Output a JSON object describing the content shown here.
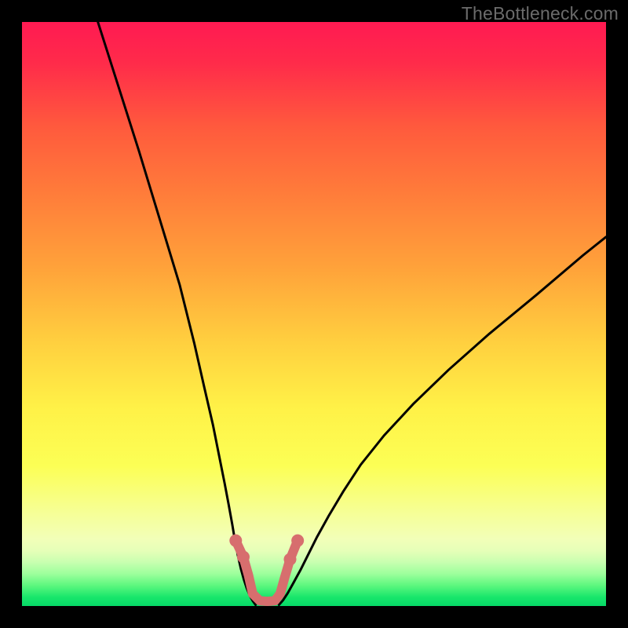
{
  "watermark": "TheBottleneck.com",
  "chart_data": {
    "type": "line",
    "title": "",
    "xlabel": "",
    "ylabel": "",
    "xlim": [
      0,
      100
    ],
    "ylim": [
      0,
      100
    ],
    "gradient_stops": [
      {
        "offset": 0,
        "color": "#ff1a52"
      },
      {
        "offset": 0.07,
        "color": "#ff2b4a"
      },
      {
        "offset": 0.18,
        "color": "#ff5a3d"
      },
      {
        "offset": 0.3,
        "color": "#ff7e3a"
      },
      {
        "offset": 0.42,
        "color": "#ffa23a"
      },
      {
        "offset": 0.55,
        "color": "#ffd03f"
      },
      {
        "offset": 0.66,
        "color": "#fff147"
      },
      {
        "offset": 0.76,
        "color": "#fcff55"
      },
      {
        "offset": 0.84,
        "color": "#f6ff96"
      },
      {
        "offset": 0.885,
        "color": "#f2ffb8"
      },
      {
        "offset": 0.905,
        "color": "#e6ffb8"
      },
      {
        "offset": 0.925,
        "color": "#c8ffb0"
      },
      {
        "offset": 0.945,
        "color": "#9cff9c"
      },
      {
        "offset": 0.965,
        "color": "#5cf77e"
      },
      {
        "offset": 0.985,
        "color": "#18e66b"
      },
      {
        "offset": 1.0,
        "color": "#06d967"
      }
    ],
    "series": [
      {
        "name": "left-branch",
        "x": [
          13.0,
          16.5,
          20.0,
          23.5,
          27.0,
          29.5,
          31.2,
          32.7,
          33.8,
          34.7,
          35.4,
          36.0,
          36.5,
          37.0,
          37.5,
          38.0,
          38.5,
          39.0,
          39.5,
          40.0
        ],
        "y": [
          100.0,
          89.0,
          78.0,
          66.5,
          55.0,
          45.0,
          37.5,
          31.0,
          25.5,
          21.0,
          17.3,
          14.0,
          11.0,
          8.5,
          6.3,
          4.5,
          3.0,
          1.8,
          0.9,
          0.2
        ]
      },
      {
        "name": "right-branch",
        "x": [
          44.0,
          44.7,
          45.5,
          46.5,
          47.7,
          49.0,
          50.5,
          52.5,
          55.0,
          58.0,
          62.0,
          67.0,
          73.0,
          80.0,
          88.0,
          96.0,
          100.0
        ],
        "y": [
          0.2,
          1.0,
          2.2,
          4.0,
          6.2,
          8.8,
          11.8,
          15.4,
          19.6,
          24.2,
          29.2,
          34.6,
          40.4,
          46.6,
          53.2,
          60.0,
          63.2
        ]
      }
    ],
    "bottom_marker": {
      "name": "bottom-connector",
      "color": "#d76e6e",
      "stroke_width": 12,
      "x": [
        36.6,
        37.9,
        38.8,
        39.5,
        40.7,
        42.0,
        43.3,
        44.2,
        44.9,
        45.9,
        47.2
      ],
      "y": [
        11.2,
        8.4,
        5.2,
        2.1,
        0.9,
        0.8,
        0.9,
        2.1,
        4.6,
        8.0,
        11.2
      ]
    },
    "bottom_dots": {
      "name": "bottom-dots",
      "color": "#d76e6e",
      "r": 8,
      "points": [
        {
          "x": 36.6,
          "y": 11.2
        },
        {
          "x": 37.9,
          "y": 8.4
        },
        {
          "x": 45.9,
          "y": 8.0
        },
        {
          "x": 47.2,
          "y": 11.2
        }
      ]
    }
  }
}
